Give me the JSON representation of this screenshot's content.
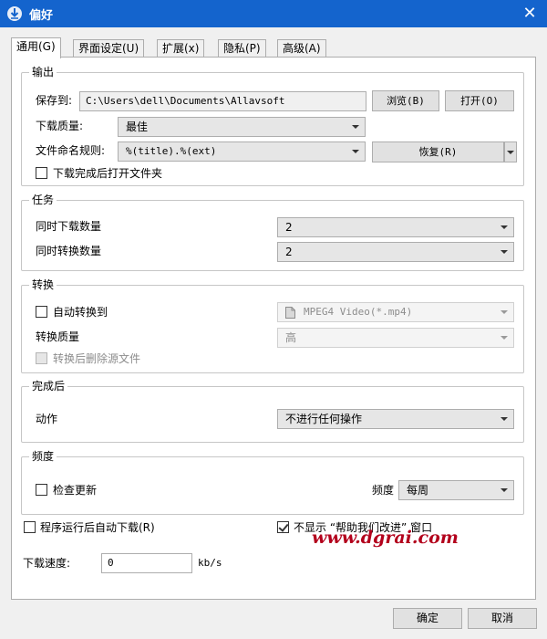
{
  "window": {
    "title": "偏好",
    "close_glyph": "✕"
  },
  "tabs": [
    {
      "label": "通用(G)",
      "active": true
    },
    {
      "label": "界面设定(U)",
      "active": false
    },
    {
      "label": "扩展(x)",
      "active": false
    },
    {
      "label": "隐私(P)",
      "active": false
    },
    {
      "label": "高级(A)",
      "active": false
    }
  ],
  "output": {
    "title": "输出",
    "save_to_label": "保存到:",
    "save_path": "C:\\Users\\dell\\Documents\\Allavsoft",
    "browse_label": "浏览(B)",
    "open_label": "打开(O)",
    "quality_label": "下载质量:",
    "quality_value": "最佳",
    "naming_label": "文件命名规则:",
    "naming_value": "%(title).%(ext)",
    "restore_label": "恢复(R)",
    "open_folder_label": "下载完成后打开文件夹",
    "open_folder_checked": false
  },
  "tasks": {
    "title": "任务",
    "concurrent_download_label": "同时下载数量",
    "concurrent_download_value": "2",
    "concurrent_convert_label": "同时转换数量",
    "concurrent_convert_value": "2"
  },
  "convert": {
    "title": "转换",
    "auto_convert_label": "自动转换到",
    "auto_convert_checked": false,
    "format_value": "MPEG4 Video(*.mp4)",
    "format_icon": "video-file-icon",
    "quality_label": "转换质量",
    "quality_value": "高",
    "delete_source_label": "转换后删除源文件",
    "delete_source_checked": false
  },
  "after_complete": {
    "title": "完成后",
    "action_label": "动作",
    "action_value": "不进行任何操作"
  },
  "frequency": {
    "title": "频度",
    "check_update_label": "检查更新",
    "check_update_checked": false,
    "freq_label": "频度",
    "freq_value": "每周"
  },
  "misc": {
    "auto_download_label": "程序运行后自动下载(R)",
    "auto_download_checked": false,
    "hide_help_label": "不显示 “帮助我们改进” 窗口",
    "hide_help_checked": true,
    "speed_label": "下载速度:",
    "speed_value": "0",
    "speed_unit": "kb/s"
  },
  "watermark": "www.dgrai.com",
  "buttons": {
    "ok_label": "确定",
    "cancel_label": "取消"
  },
  "colors": {
    "titlebar": "#1464cd",
    "watermark": "#b3001c"
  }
}
